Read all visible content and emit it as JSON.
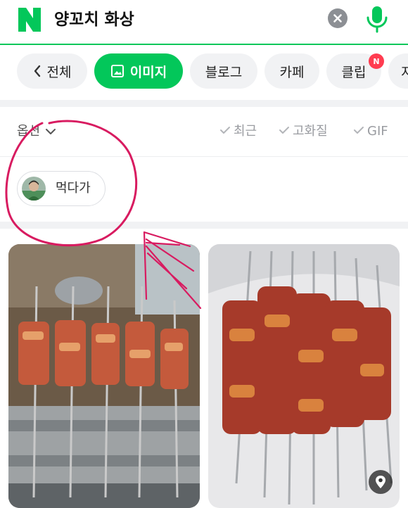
{
  "search": {
    "logo_letter": "N",
    "query": "양꼬치 화상",
    "clear_icon": "close-circle-icon",
    "mic_icon": "microphone-icon"
  },
  "tabs": [
    {
      "label": "전체",
      "icon": "chevron-left-icon",
      "active": false
    },
    {
      "label": "이미지",
      "icon": "image-icon",
      "active": true
    },
    {
      "label": "블로그",
      "active": false
    },
    {
      "label": "카페",
      "active": false
    },
    {
      "label": "클립",
      "active": false,
      "badge": "N"
    },
    {
      "label": "지",
      "active": false
    }
  ],
  "options": {
    "toggle_label": "옵션",
    "filters": [
      "최근",
      "고화질",
      "GIF"
    ]
  },
  "source_filter": {
    "label": "먹다가"
  },
  "results": [
    {
      "name": "lamb-skewers-on-grill-photo"
    },
    {
      "name": "raw-lamb-skewers-photo",
      "pin_icon": "location-pin-icon"
    }
  ],
  "colors": {
    "accent": "#03c75a",
    "badge": "#ff3c50",
    "annotation": "#d81b60"
  }
}
